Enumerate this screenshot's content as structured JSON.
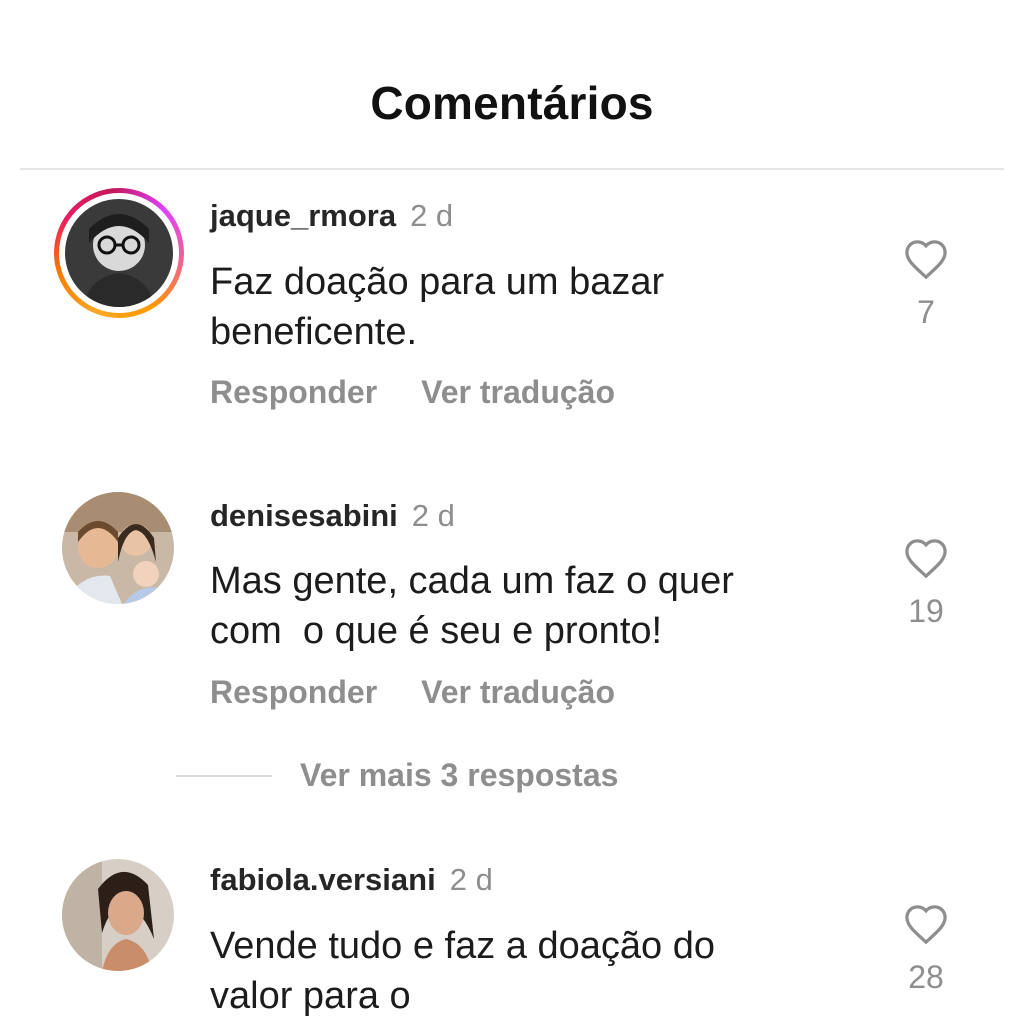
{
  "header": {
    "title": "Comentários"
  },
  "comments": [
    {
      "username": "jaque_rmora",
      "time": "2 d",
      "text_lines": [
        "Faz doação para um bazar",
        "beneficente."
      ],
      "likes": "7",
      "reply_label": "Responder",
      "translate_label": "Ver tradução"
    },
    {
      "username": "denisesabini",
      "time": "2 d",
      "text_lines": [
        "Mas gente, cada um faz o quer",
        "com  o que é seu e pronto!"
      ],
      "likes": "19",
      "reply_label": "Responder",
      "translate_label": "Ver tradução",
      "more_replies": "Ver mais 3 respostas"
    },
    {
      "username": "fabiola.versiani",
      "time": "2 d",
      "text_lines": [
        "Vende tudo e faz a doação do",
        "valor para o"
      ],
      "likes": "28"
    }
  ],
  "colors": {
    "muted": "#8e8e8e",
    "text": "#1c1c1c",
    "ring_start": "#f9a825",
    "ring_end": "#e91e63"
  },
  "icons": {
    "like": "heart-outline-icon"
  }
}
